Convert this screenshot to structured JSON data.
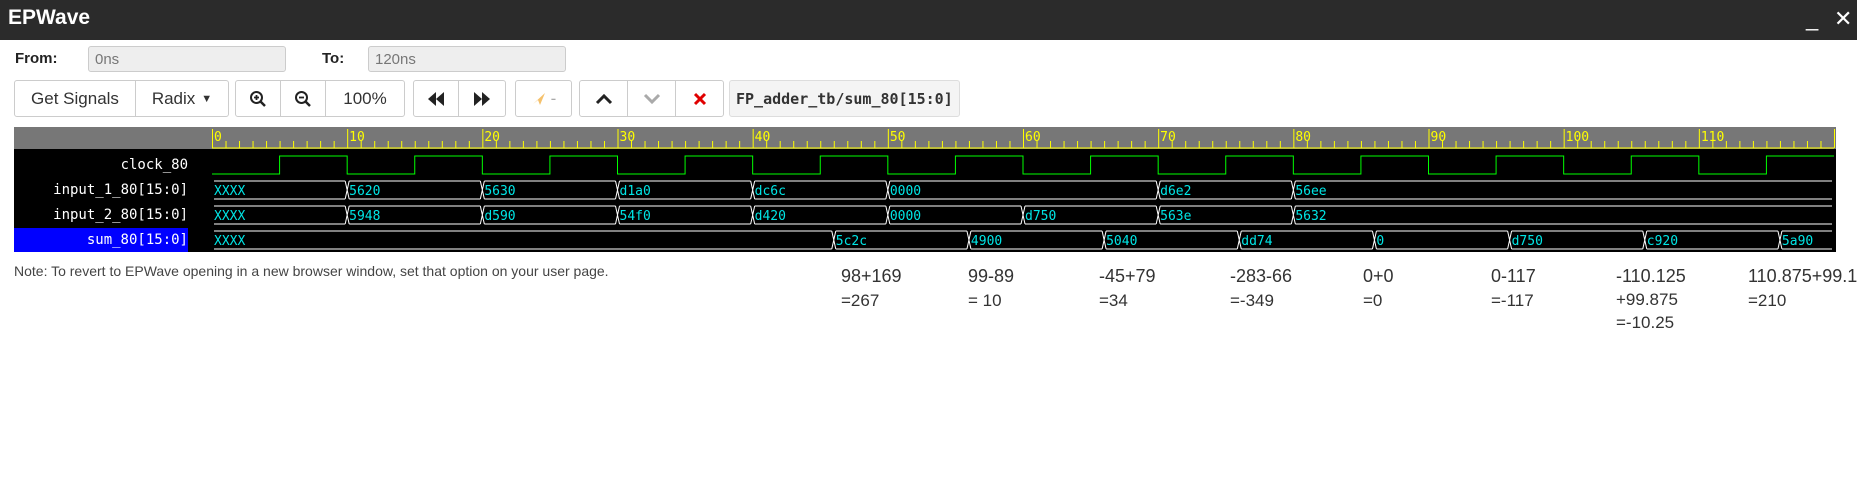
{
  "app": {
    "title": "EPWave",
    "minimize": "_",
    "close": "✕"
  },
  "range": {
    "from_label": "From:",
    "from_value": "0ns",
    "to_label": "To:",
    "to_value": "120ns"
  },
  "toolbar": {
    "get_signals": "Get Signals",
    "radix": "Radix",
    "zoom_level": "100%",
    "marker_label": "-",
    "selected_signal": "FP_adder_tb/sum_80[15:0]"
  },
  "icons": {
    "zoom_in": "zoom-in-icon",
    "zoom_out": "zoom-out-icon",
    "rewind": "rewind-icon",
    "fast_forward": "fast-forward-icon",
    "marker": "marker-icon",
    "up": "chevron-up-icon",
    "down": "chevron-down-icon",
    "delete": "delete-icon"
  },
  "colors": {
    "clock": "#00ff00",
    "clock_alt": "#00e0ff",
    "bus_text": "#00e5e5",
    "ruler": "#ffff00",
    "selected": "#0000ff"
  },
  "timeline": {
    "start": 0,
    "end": 120,
    "ticks": [
      "0",
      "10",
      "20",
      "30",
      "40",
      "50",
      "60",
      "70",
      "80",
      "90",
      "100",
      "110"
    ]
  },
  "signals": [
    {
      "name": "clock_80",
      "type": "clock",
      "period": 10
    },
    {
      "name": "input_1_80[15:0]",
      "type": "bus",
      "segments": [
        {
          "t": 0,
          "v": "XXXX"
        },
        {
          "t": 10,
          "v": "5620"
        },
        {
          "t": 20,
          "v": "5630"
        },
        {
          "t": 30,
          "v": "d1a0"
        },
        {
          "t": 40,
          "v": "dc6c"
        },
        {
          "t": 50,
          "v": "0000"
        },
        {
          "t": 70,
          "v": "d6e2"
        },
        {
          "t": 80,
          "v": "56ee"
        }
      ]
    },
    {
      "name": "input_2_80[15:0]",
      "type": "bus",
      "segments": [
        {
          "t": 0,
          "v": "XXXX"
        },
        {
          "t": 10,
          "v": "5948"
        },
        {
          "t": 20,
          "v": "d590"
        },
        {
          "t": 30,
          "v": "54f0"
        },
        {
          "t": 40,
          "v": "d420"
        },
        {
          "t": 50,
          "v": "0000"
        },
        {
          "t": 60,
          "v": "d750"
        },
        {
          "t": 70,
          "v": "563e"
        },
        {
          "t": 80,
          "v": "5632"
        }
      ]
    },
    {
      "name": "sum_80[15:0]",
      "type": "bus",
      "selected": true,
      "segments": [
        {
          "t": 0,
          "v": "XXXX"
        },
        {
          "t": 46,
          "v": "5c2c"
        },
        {
          "t": 56,
          "v": "4900"
        },
        {
          "t": 66,
          "v": "5040"
        },
        {
          "t": 76,
          "v": "dd74"
        },
        {
          "t": 86,
          "v": "0"
        },
        {
          "t": 96,
          "v": "d750"
        },
        {
          "t": 106,
          "v": "c920"
        },
        {
          "t": 116,
          "v": "5a90"
        }
      ]
    }
  ],
  "note": "Note: To revert to EPWave opening in a new browser window, set that option on your user page.",
  "annotations": [
    {
      "expr": "98+169",
      "result": "=267"
    },
    {
      "expr": "99-89",
      "result": "= 10"
    },
    {
      "expr": "-45+79",
      "result": "=34"
    },
    {
      "expr": "-283-66",
      "result": "=-349"
    },
    {
      "expr": "0+0",
      "result": "=0"
    },
    {
      "expr": "0-117",
      "result": "=-117"
    },
    {
      "expr": "-110.125",
      "line2": "+99.875",
      "result": "=-10.25"
    },
    {
      "expr": "110.875+99.1",
      "result": "=210"
    }
  ]
}
